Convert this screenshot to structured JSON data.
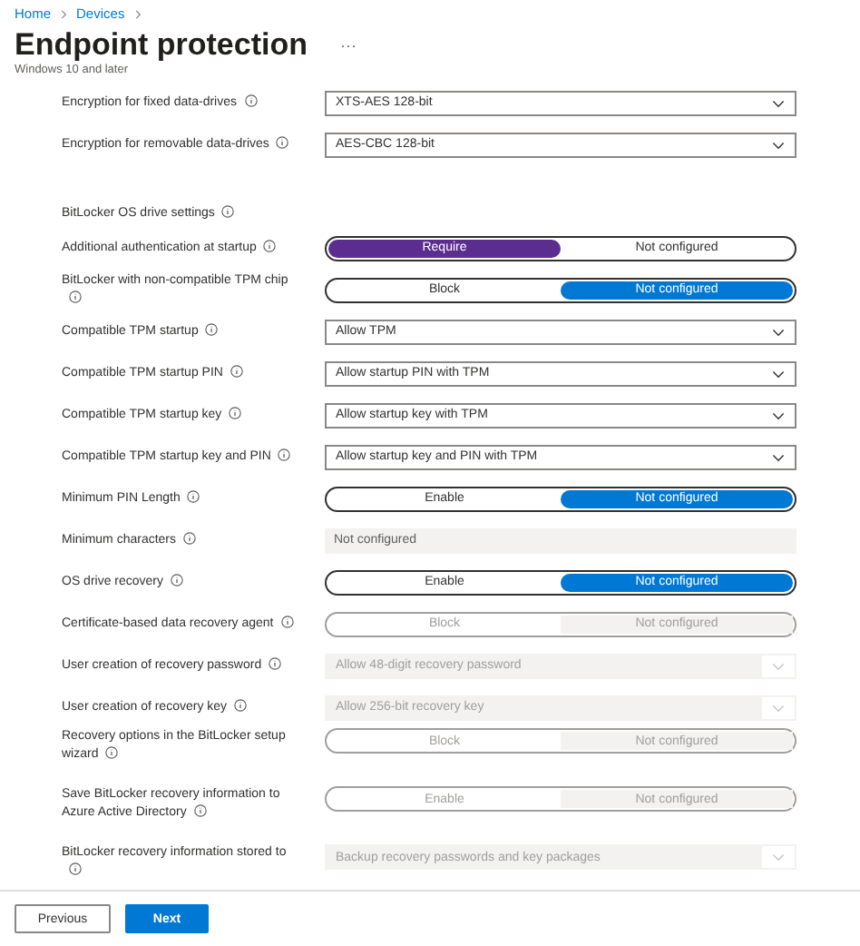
{
  "breadcrumb": [
    "Home",
    "Devices"
  ],
  "title": "Endpoint protection",
  "more": "···",
  "subtitle": "Windows 10 and later",
  "settings": [
    {
      "kind": "dropdown",
      "label": "Encryption for fixed data-drives",
      "value": "XTS-AES 128-bit",
      "disabled": false
    },
    {
      "kind": "dropdown",
      "label": "Encryption for removable data-drives",
      "value": "AES-CBC 128-bit",
      "disabled": false
    },
    {
      "kind": "header",
      "label": "BitLocker OS drive settings"
    },
    {
      "kind": "toggle",
      "label": "Additional authentication at startup",
      "color": "#5c2d91",
      "disabled": false,
      "options": [
        {
          "label": "Require",
          "selected": true
        },
        {
          "label": "Not configured",
          "selected": false
        }
      ]
    },
    {
      "kind": "toggle",
      "label": "BitLocker with non-compatible TPM chip",
      "color": "#0078d4",
      "disabled": false,
      "options": [
        {
          "label": "Block",
          "selected": false
        },
        {
          "label": "Not configured",
          "selected": true
        }
      ]
    },
    {
      "kind": "dropdown",
      "label": "Compatible TPM startup",
      "value": "Allow TPM",
      "disabled": false
    },
    {
      "kind": "dropdown",
      "label": "Compatible TPM startup PIN",
      "value": "Allow startup PIN with TPM",
      "disabled": false
    },
    {
      "kind": "dropdown",
      "label": "Compatible TPM startup key",
      "value": "Allow startup key with TPM",
      "disabled": false
    },
    {
      "kind": "dropdown",
      "label": "Compatible TPM startup key and PIN",
      "value": "Allow startup key and PIN with TPM",
      "disabled": false
    },
    {
      "kind": "toggle",
      "label": "Minimum PIN Length",
      "color": "#0078d4",
      "disabled": false,
      "options": [
        {
          "label": "Enable",
          "selected": false
        },
        {
          "label": "Not configured",
          "selected": true
        }
      ]
    },
    {
      "kind": "text",
      "label": "Minimum characters",
      "value": "Not configured",
      "disabled": true
    },
    {
      "kind": "toggle",
      "label": "OS drive recovery",
      "color": "#0078d4",
      "disabled": false,
      "options": [
        {
          "label": "Enable",
          "selected": false
        },
        {
          "label": "Not configured",
          "selected": true
        }
      ]
    },
    {
      "kind": "toggle",
      "label": "Certificate-based data recovery agent",
      "disabled": true,
      "options": [
        {
          "label": "Block",
          "selected": false
        },
        {
          "label": "Not configured",
          "selected": true
        }
      ]
    },
    {
      "kind": "dropdown",
      "label": "User creation of recovery password",
      "value": "Allow 48-digit recovery password",
      "disabled": true
    },
    {
      "kind": "dropdown",
      "label": "User creation of recovery key",
      "value": "Allow 256-bit recovery key",
      "disabled": true
    },
    {
      "kind": "toggle",
      "label": "Recovery options in the BitLocker setup wizard",
      "disabled": true,
      "options": [
        {
          "label": "Block",
          "selected": false
        },
        {
          "label": "Not configured",
          "selected": true
        }
      ]
    },
    {
      "kind": "toggle",
      "label": "Save BitLocker recovery information to Azure Active Directory",
      "disabled": true,
      "options": [
        {
          "label": "Enable",
          "selected": false
        },
        {
          "label": "Not configured",
          "selected": true
        }
      ]
    },
    {
      "kind": "dropdown",
      "label": "BitLocker recovery information stored to",
      "value": "Backup recovery passwords and key packages",
      "disabled": true
    }
  ],
  "buttons": [
    {
      "label": "Previous",
      "primary": false
    },
    {
      "label": "Next",
      "primary": true
    }
  ]
}
